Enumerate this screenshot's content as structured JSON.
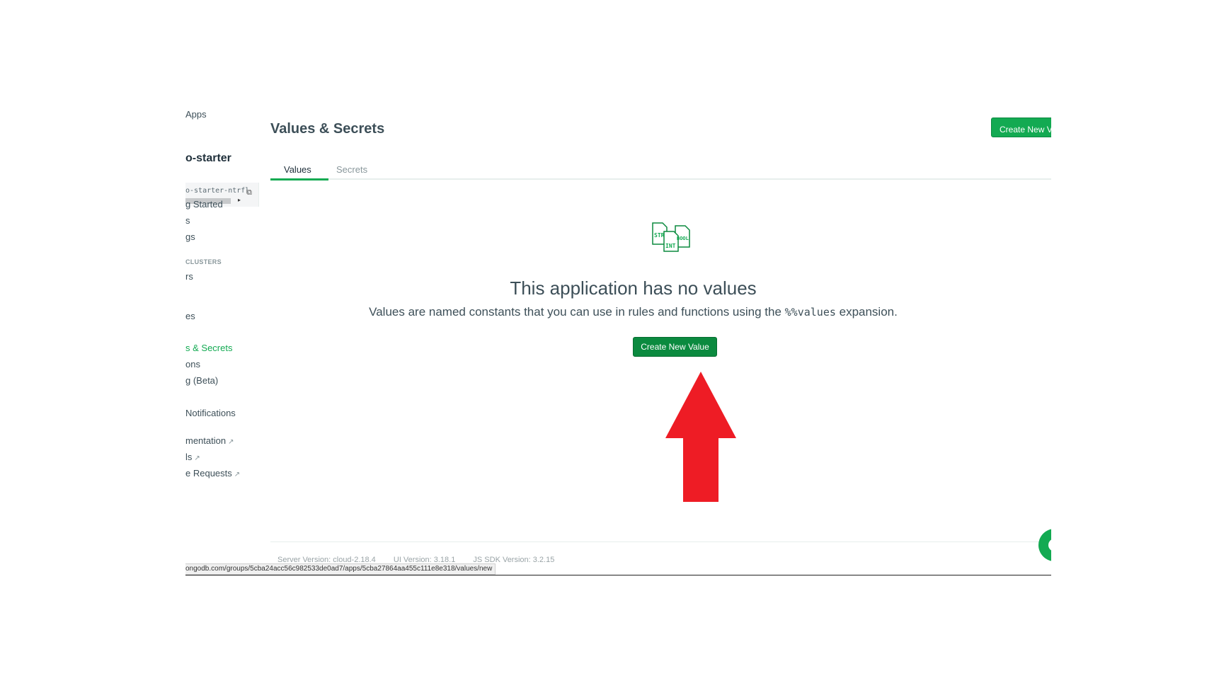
{
  "sidebar": {
    "back_link": "Apps",
    "app_name": "o-starter",
    "app_id": "o-starter-ntrfl",
    "items": [
      {
        "label": "g Started"
      },
      {
        "label": "s"
      },
      {
        "label": "gs"
      },
      {
        "label": "rs"
      },
      {
        "label": "es"
      },
      {
        "label": "s & Secrets"
      },
      {
        "label": "ons"
      },
      {
        "label": "g (Beta)"
      },
      {
        "label": "Notifications"
      },
      {
        "label": "mentation"
      },
      {
        "label": "ls"
      },
      {
        "label": "e Requests"
      }
    ],
    "section_clusters": "CLUSTERS"
  },
  "main": {
    "title": "Values & Secrets",
    "header_button": "Create New Value",
    "tabs": [
      {
        "label": "Values",
        "active": true
      },
      {
        "label": "Secrets",
        "active": false
      }
    ],
    "empty_state": {
      "icon_labels": [
        "STR",
        "INT",
        "BOOL"
      ],
      "title": "This application has no values",
      "desc_before": "Values are named constants that you can use in rules and functions using the ",
      "desc_code": "%%values",
      "desc_after": " expansion.",
      "button": "Create New Value"
    },
    "footer": {
      "server_version": "Server Version: cloud-2.18.4",
      "ui_version": "UI Version: 3.18.1",
      "sdk_version": "JS SDK Version: 3.2.15"
    }
  },
  "statusbar_url": "ongodb.com/groups/5cba24acc56c982533de0ad7/apps/5cba27864aa455c111e8e318/values/new",
  "colors": {
    "brand_green": "#13aa52",
    "button_green": "#0b8a3f",
    "annotation_red": "#ee1c25"
  },
  "annotation": {
    "type": "arrow-up",
    "target": "create-new-value-button"
  }
}
